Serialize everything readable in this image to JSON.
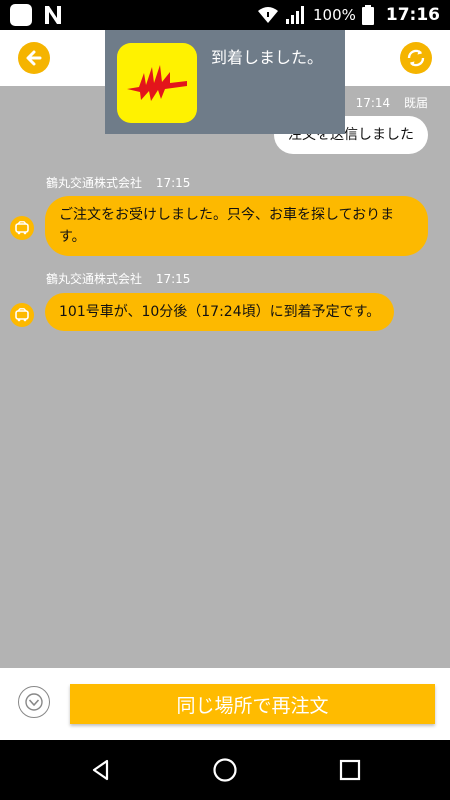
{
  "status_bar": {
    "battery_level": "100%",
    "time": "17:16",
    "icons": [
      "app-square-icon",
      "n-app-icon",
      "wifi-icon",
      "signal-icon",
      "battery-icon"
    ]
  },
  "app_bar": {
    "back_icon": "arrow-left-icon",
    "refresh_icon": "refresh-icon",
    "accent_color": "#f5b400"
  },
  "notification": {
    "text": "到着しました。",
    "icon": "brand-logo-icon",
    "bg_color": "#6f7c89",
    "icon_bg_color": "#fff200"
  },
  "chat": {
    "background_color": "#b3b3b3",
    "messages": [
      {
        "direction": "outgoing",
        "time": "17:14",
        "read_status": "既届",
        "text": "注文を送信しました"
      },
      {
        "direction": "incoming",
        "sender": "鶴丸交通株式会社",
        "time": "17:15",
        "text": "ご注文をお受けしました。只今、お車を探しております。"
      },
      {
        "direction": "incoming",
        "sender": "鶴丸交通株式会社",
        "time": "17:15",
        "text": "101号車が、10分後（17:24頃）に到着予定です。"
      }
    ]
  },
  "bottom_bar": {
    "reorder_label": "同じ場所で再注文",
    "reorder_color": "#ffbb00",
    "secondary_icon": "chevron-down-circle-icon"
  },
  "nav_bar": {
    "buttons": [
      "back-triangle-icon",
      "home-circle-icon",
      "recents-square-icon"
    ]
  }
}
